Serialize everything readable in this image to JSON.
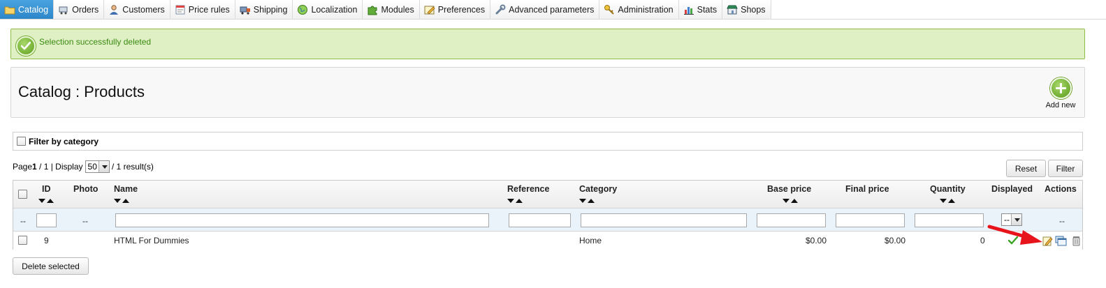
{
  "tabs": [
    {
      "label": "Catalog",
      "icon": "folder-icon",
      "active": true
    },
    {
      "label": "Orders",
      "icon": "cart-icon"
    },
    {
      "label": "Customers",
      "icon": "user-icon"
    },
    {
      "label": "Price rules",
      "icon": "price-tag-icon"
    },
    {
      "label": "Shipping",
      "icon": "truck-icon"
    },
    {
      "label": "Localization",
      "icon": "globe-icon"
    },
    {
      "label": "Modules",
      "icon": "puzzle-icon"
    },
    {
      "label": "Preferences",
      "icon": "preferences-icon"
    },
    {
      "label": "Advanced parameters",
      "icon": "wrench-icon"
    },
    {
      "label": "Administration",
      "icon": "key-icon"
    },
    {
      "label": "Stats",
      "icon": "bar-chart-icon"
    },
    {
      "label": "Shops",
      "icon": "shop-icon"
    }
  ],
  "confirmation": {
    "message": "Selection successfully deleted"
  },
  "page": {
    "title": "Catalog : Products",
    "add_new_label": "Add new"
  },
  "category_filter": {
    "label": "Filter by category"
  },
  "pagination": {
    "page_word": "Page",
    "current": "1",
    "of_text": " / 1 | Display",
    "per_page": "50",
    "results_text": "/ 1 result(s)"
  },
  "buttons": {
    "reset": "Reset",
    "filter": "Filter",
    "delete_selected": "Delete selected"
  },
  "table": {
    "headers": {
      "id": "ID",
      "photo": "Photo",
      "name": "Name",
      "reference": "Reference",
      "category": "Category",
      "base_price": "Base price",
      "final_price": "Final price",
      "quantity": "Quantity",
      "displayed": "Displayed",
      "actions": "Actions"
    },
    "filter_row": {
      "placeholder_dash": "--",
      "displayed_select": "--"
    },
    "rows": [
      {
        "id": "9",
        "photo": "",
        "name": "HTML For Dummies",
        "reference": "",
        "category": "Home",
        "base_price": "$0.00",
        "final_price": "$0.00",
        "quantity": "0",
        "displayed": true
      }
    ]
  },
  "colors": {
    "success_bg": "#dff0c4",
    "success_text": "#3b8a12",
    "active_tab": "#2c86c9",
    "filter_row_bg": "#eaf2fa",
    "annotation_arrow": "#e8141b"
  }
}
